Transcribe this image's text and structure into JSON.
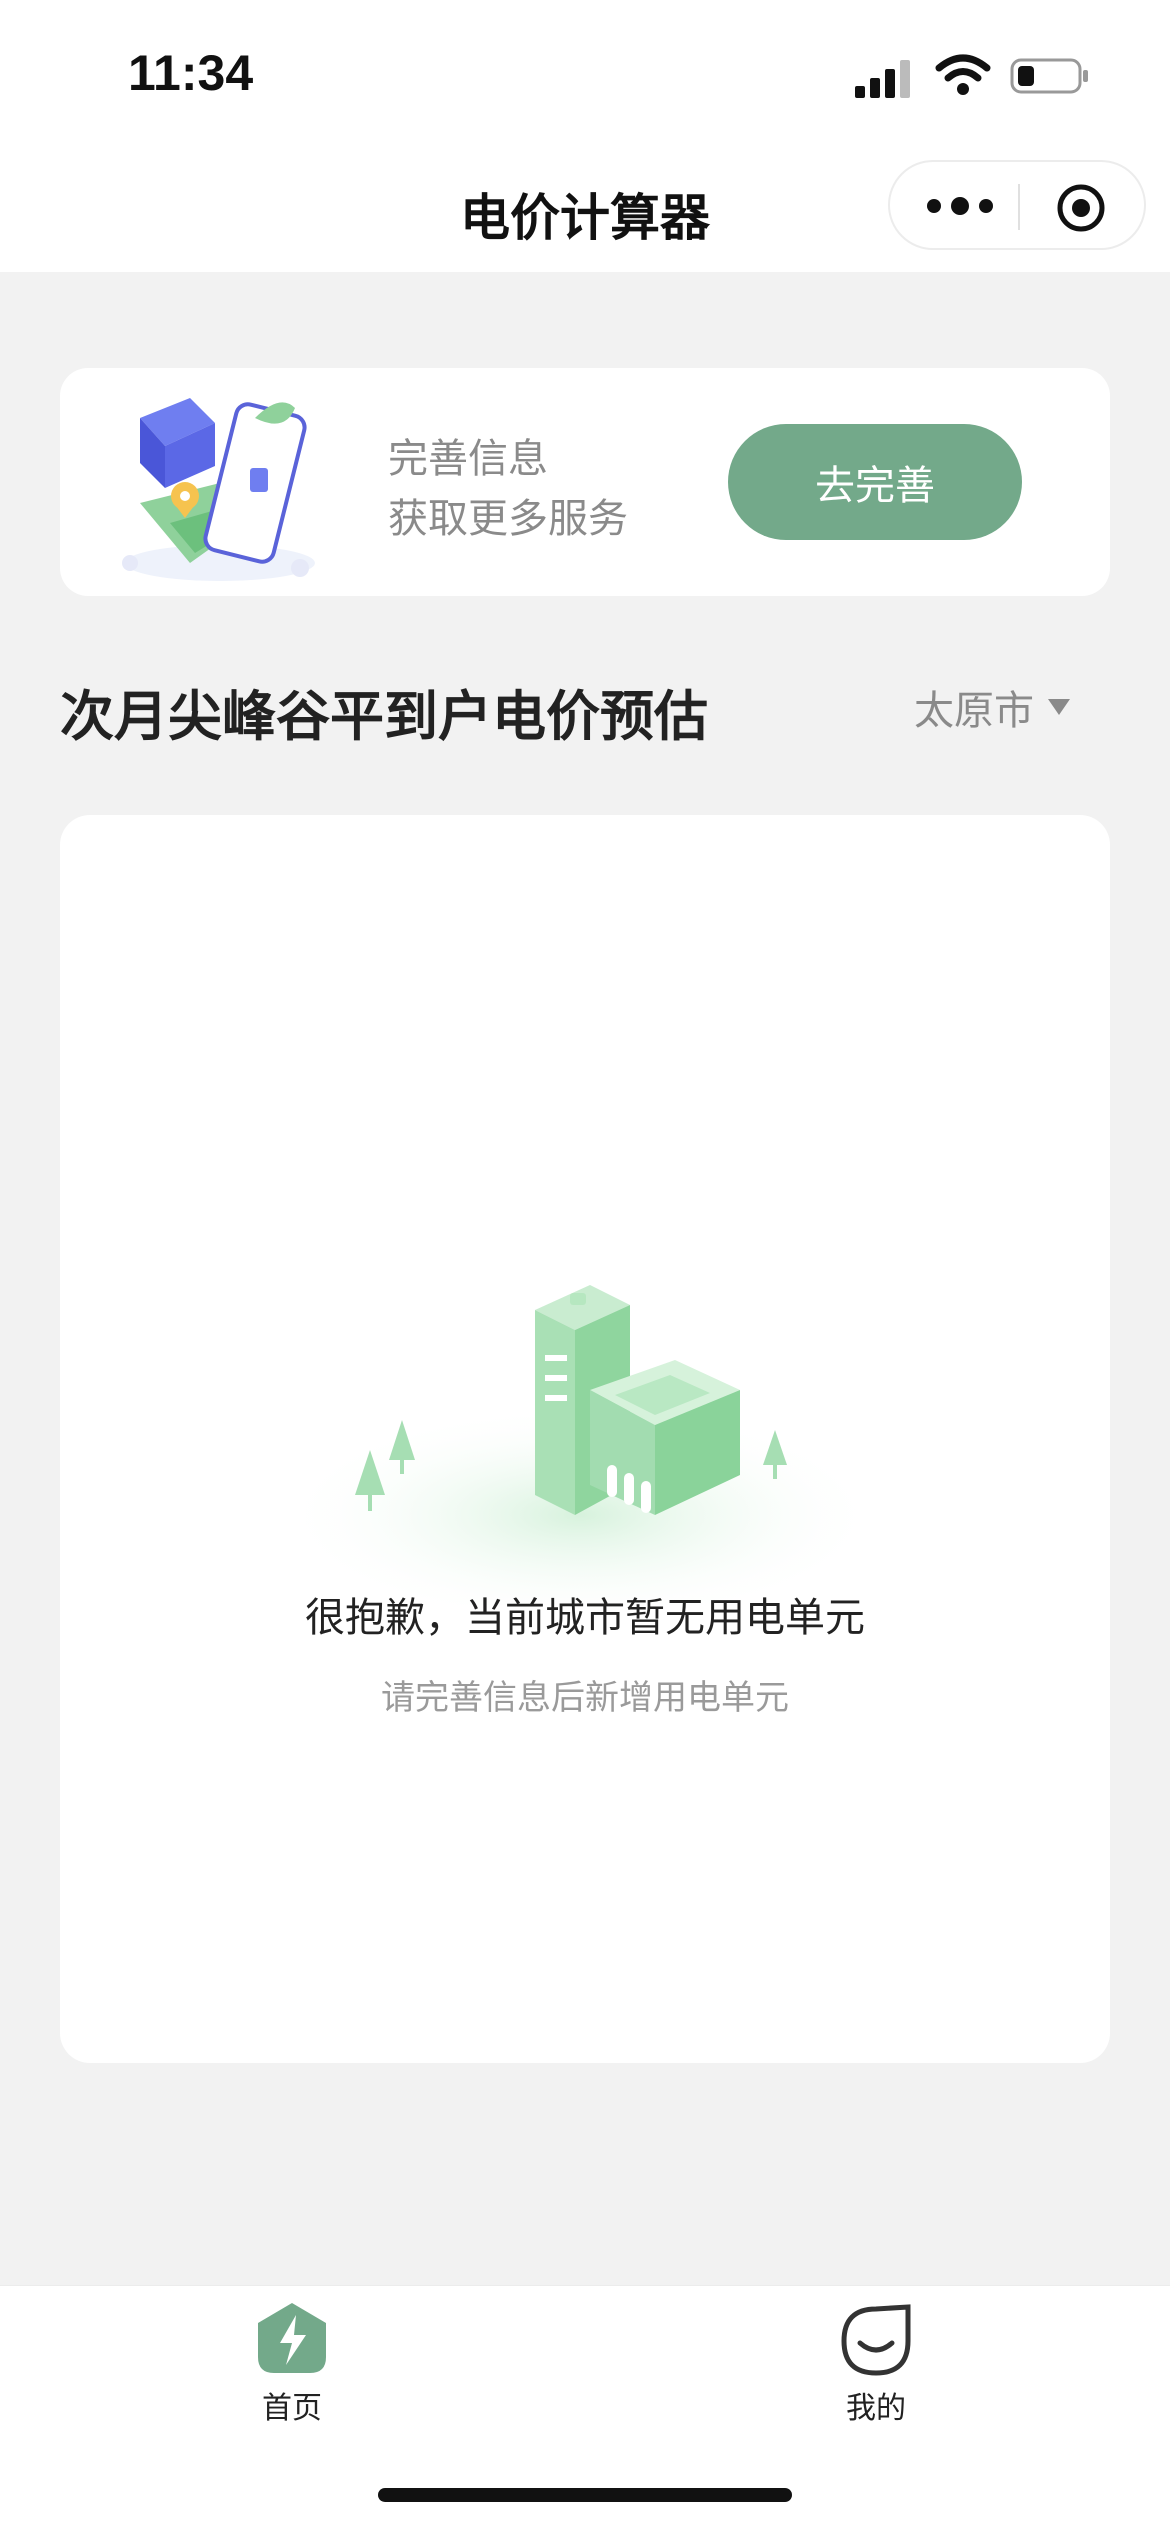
{
  "status_bar": {
    "time": "11:34"
  },
  "nav": {
    "title": "电价计算器"
  },
  "promo": {
    "line1": "完善信息",
    "line2": "获取更多服务",
    "button_label": "去完善"
  },
  "section": {
    "title": "次月尖峰谷平到户电价预估",
    "city": "太原市"
  },
  "empty_state": {
    "title": "很抱歉，当前城市暂无用电单元",
    "subtitle": "请完善信息后新增用电单元"
  },
  "tabs": [
    {
      "label": "首页",
      "icon": "lightning-icon",
      "active": true
    },
    {
      "label": "我的",
      "icon": "smile-icon",
      "active": false
    }
  ],
  "colors": {
    "accent": "#73a98a",
    "background": "#f2f2f2"
  }
}
